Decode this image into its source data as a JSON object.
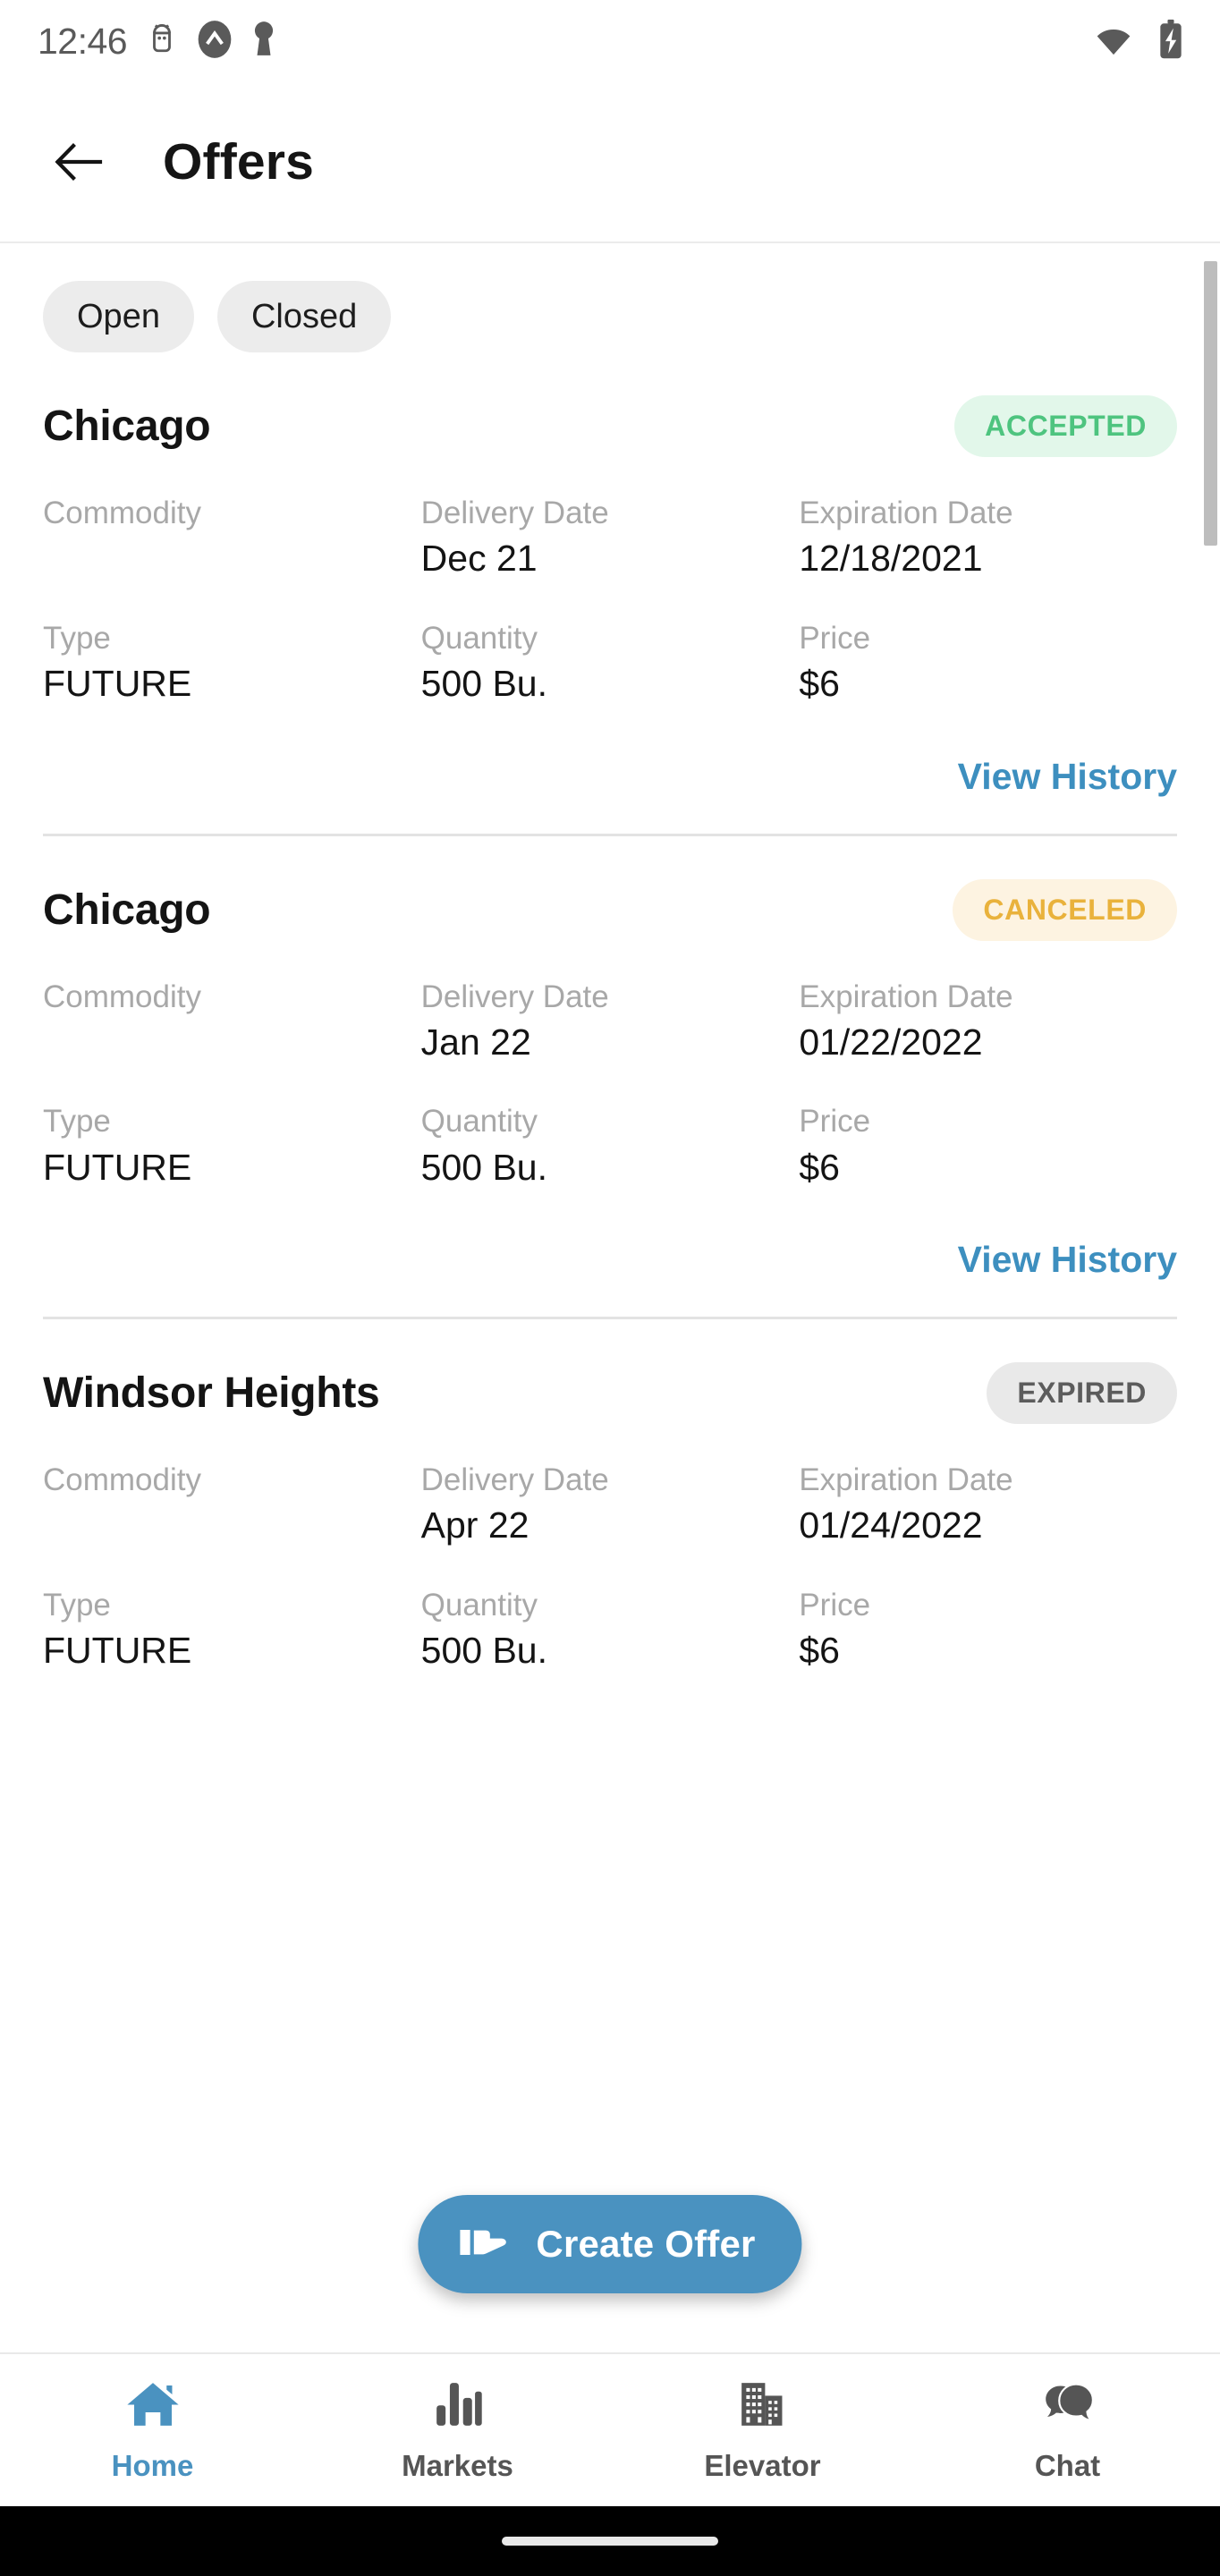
{
  "status_bar": {
    "time": "12:46",
    "left_icons": [
      "android-debug-icon",
      "app-badge-icon",
      "keyhole-icon"
    ],
    "right_icons": [
      "wifi-icon",
      "battery-charging-icon"
    ]
  },
  "app_bar": {
    "back_icon": "arrow-left-icon",
    "title": "Offers"
  },
  "filters": {
    "chips": [
      {
        "label": "Open",
        "selected": false
      },
      {
        "label": "Closed",
        "selected": false
      }
    ]
  },
  "column_labels": {
    "commodity": "Commodity",
    "delivery_date": "Delivery Date",
    "expiration_date": "Expiration Date",
    "type": "Type",
    "quantity": "Quantity",
    "price": "Price"
  },
  "links": {
    "view_history": "View History"
  },
  "offers": [
    {
      "location": "Chicago",
      "status": "ACCEPTED",
      "status_kind": "accepted",
      "commodity": "",
      "delivery_date": "Dec 21",
      "expiration_date": "12/18/2021",
      "type": "FUTURE",
      "quantity": "500 Bu.",
      "price": "$6"
    },
    {
      "location": "Chicago",
      "status": "CANCELED",
      "status_kind": "canceled",
      "commodity": "",
      "delivery_date": "Jan 22",
      "expiration_date": "01/22/2022",
      "type": "FUTURE",
      "quantity": "500 Bu.",
      "price": "$6"
    },
    {
      "location": "Windsor Heights",
      "status": "EXPIRED",
      "status_kind": "expired",
      "commodity": "",
      "delivery_date": "Apr 22",
      "expiration_date": "01/24/2022",
      "type": "FUTURE",
      "quantity": "500 Bu.",
      "price": "$6"
    }
  ],
  "fab": {
    "label": "Create Offer",
    "icon": "hand-point-right-icon"
  },
  "bottom_nav": {
    "items": [
      {
        "label": "Home",
        "icon": "home-icon",
        "active": true
      },
      {
        "label": "Markets",
        "icon": "bar-chart-icon",
        "active": false
      },
      {
        "label": "Elevator",
        "icon": "buildings-icon",
        "active": false
      },
      {
        "label": "Chat",
        "icon": "chat-bubbles-icon",
        "active": false
      }
    ]
  },
  "colors": {
    "accent_blue": "#4a92c0",
    "link_blue": "#3d8fbf",
    "accepted_text": "#4ec47f",
    "accepted_bg": "#e2f7ea",
    "canceled_text": "#e9b23c",
    "canceled_bg": "#fdf3e1",
    "expired_text": "#5c5c5c",
    "expired_bg": "#e9e9e9",
    "label_gray": "#a8a8a8"
  }
}
